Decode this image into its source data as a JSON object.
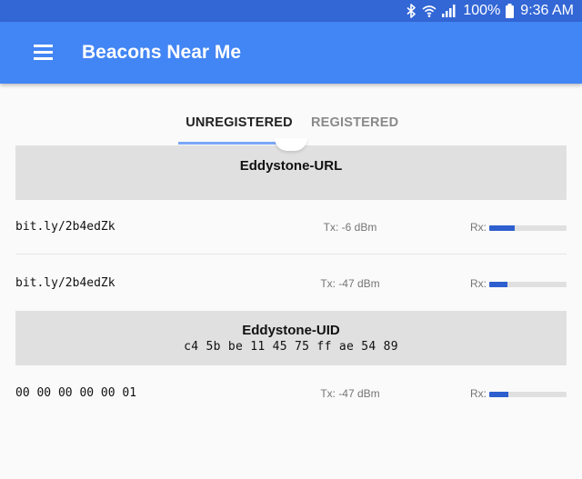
{
  "status_bar": {
    "battery": "100%",
    "time": "9:36 AM"
  },
  "app_bar": {
    "title": "Beacons Near Me"
  },
  "tabs": [
    {
      "label": "UNREGISTERED",
      "active": true
    },
    {
      "label": "REGISTERED",
      "active": false
    }
  ],
  "sections": [
    {
      "title": "Eddystone-URL",
      "subtitle": "",
      "beacons": [
        {
          "id": "bit.ly/2b4edZk",
          "tx": "Tx: -6 dBm",
          "rx_label": "Rx:",
          "rx_level": 0.33
        },
        {
          "id": "bit.ly/2b4edZk",
          "tx": "Tx: -47 dBm",
          "rx_label": "Rx:",
          "rx_level": 0.24
        }
      ]
    },
    {
      "title": "Eddystone-UID",
      "subtitle": "c4 5b be 11 45 75 ff ae 54 89",
      "beacons": [
        {
          "id": "00 00 00 00 00 01",
          "tx": "Tx: -47 dBm",
          "rx_label": "Rx:",
          "rx_level": 0.25
        }
      ]
    }
  ],
  "colors": {
    "status_bar": "#3367d6",
    "app_bar": "#4285f4",
    "rx_fill": "#2e5fcf",
    "section_header": "#e0e0e0"
  }
}
